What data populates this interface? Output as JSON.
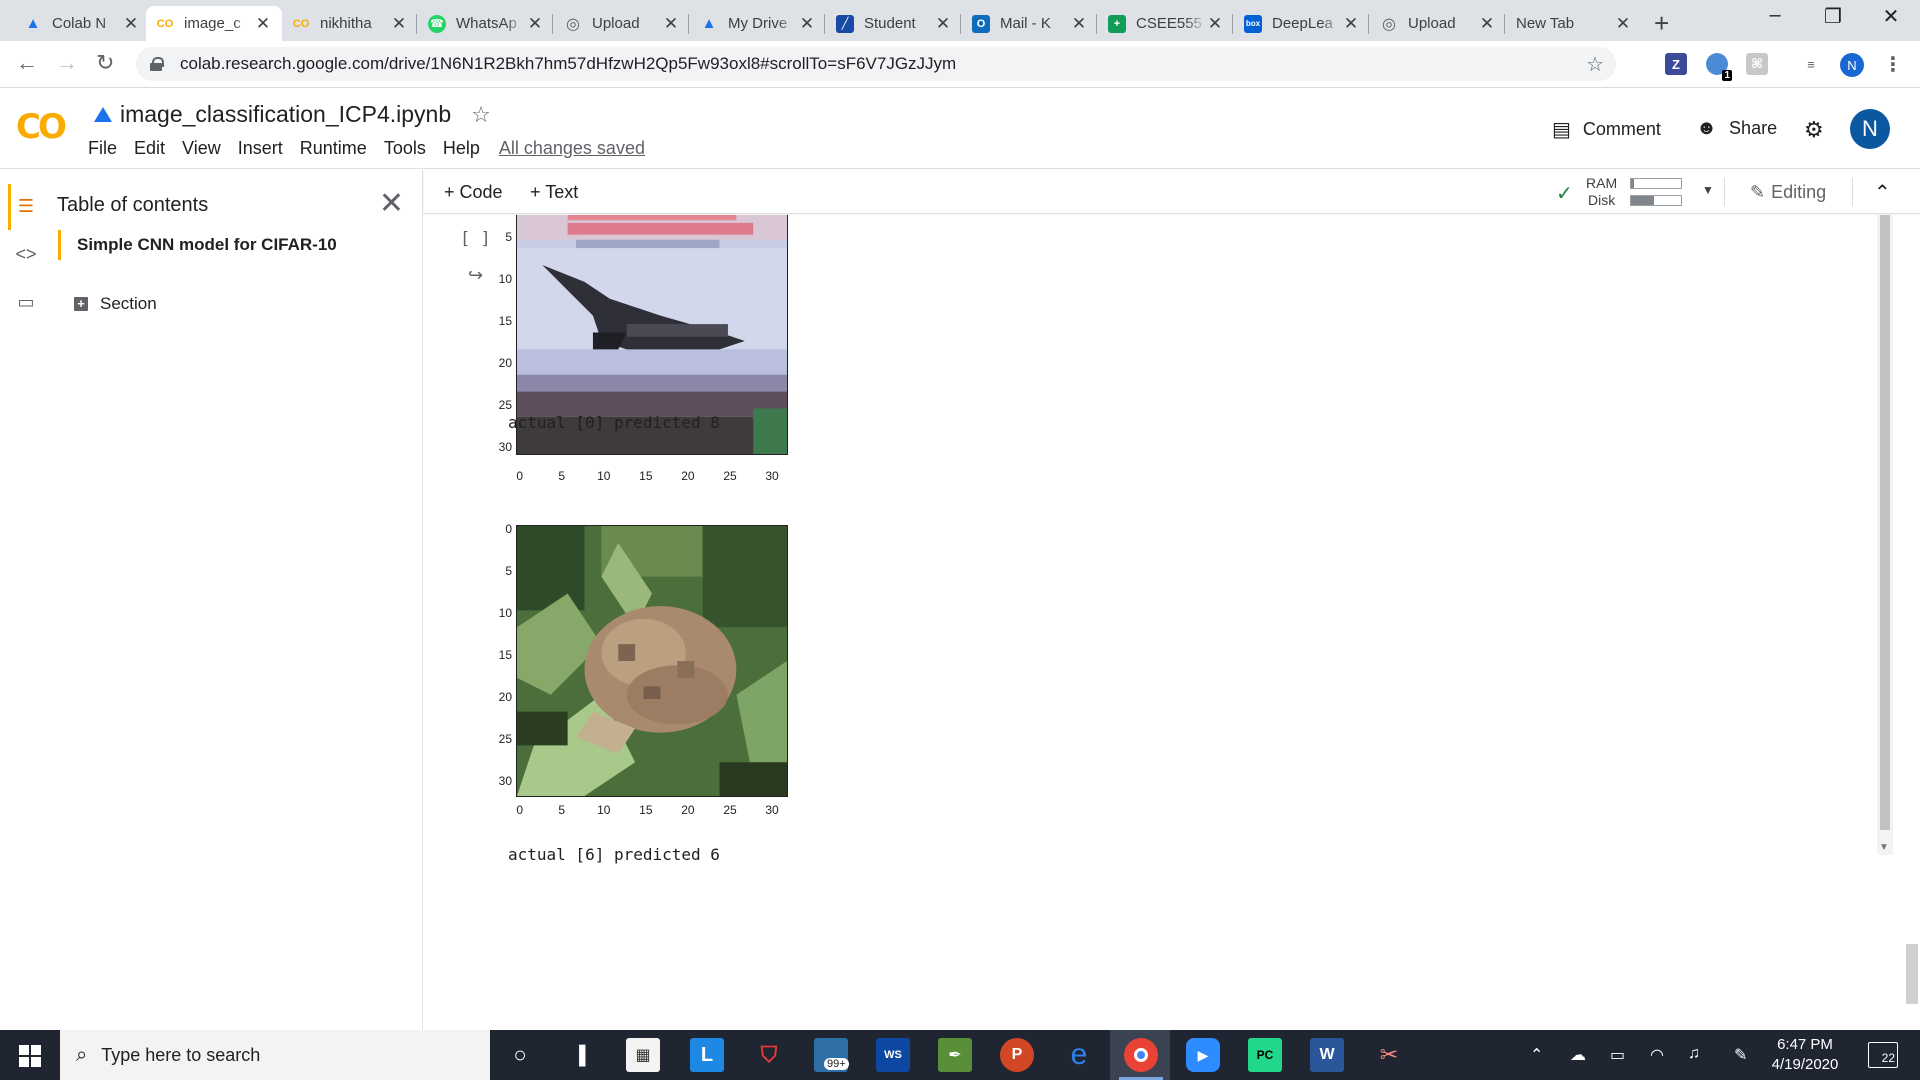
{
  "browser": {
    "tabs": [
      {
        "title": "Colab N",
        "icon": "google-drive-icon",
        "color": "#1a73e8",
        "active": false
      },
      {
        "title": "image_c",
        "icon": "colab-icon",
        "color": "#f9ab00",
        "active": true
      },
      {
        "title": "nikhitha",
        "icon": "colab-icon",
        "color": "#f9ab00",
        "active": false
      },
      {
        "title": "WhatsAp",
        "icon": "whatsapp-icon",
        "color": "#25d366",
        "active": false
      },
      {
        "title": "Upload",
        "icon": "globe-icon",
        "color": "#5f6368",
        "active": false
      },
      {
        "title": "My Drive",
        "icon": "google-drive-icon",
        "color": "#1a73e8",
        "active": false
      },
      {
        "title": "Student",
        "icon": "student-portal-icon",
        "color": "#1a4aa8",
        "active": false
      },
      {
        "title": "Mail - K",
        "icon": "outlook-icon",
        "color": "#0f6cbd",
        "active": false
      },
      {
        "title": "CSEE555",
        "icon": "sheets-icon",
        "color": "#0f9d58",
        "active": false
      },
      {
        "title": "DeepLea",
        "icon": "box-icon",
        "color": "#0061d5",
        "active": false
      },
      {
        "title": "Upload",
        "icon": "globe-icon",
        "color": "#5f6368",
        "active": false
      },
      {
        "title": "New Tab",
        "icon": "",
        "color": "",
        "active": false
      }
    ],
    "url": "colab.research.google.com/drive/1N6N1R2Bkh7hm57dHfzwH2Qp5Fw93oxl8#scrollTo=sF6V7JGzJJym",
    "profile_initial": "N",
    "extension_badge": "1"
  },
  "colab": {
    "notebook_title": "image_classification_ICP4.ipynb",
    "menu": [
      "File",
      "Edit",
      "View",
      "Insert",
      "Runtime",
      "Tools",
      "Help"
    ],
    "save_status": "All changes saved",
    "comment_label": "Comment",
    "share_label": "Share",
    "avatar_initial": "N",
    "toolbar": {
      "code_label": "+ Code",
      "text_label": "+ Text",
      "ram_label": "RAM",
      "disk_label": "Disk",
      "ram_usage": 0.05,
      "disk_usage": 0.45,
      "editing_label": "Editing"
    },
    "toc": {
      "title": "Table of contents",
      "entries": [
        "Simple CNN model for CIFAR-10"
      ],
      "section_label": "Section"
    },
    "cell": {
      "run_indicator": "[ ]",
      "plots": [
        {
          "subject": "airplane",
          "yticks": [
            "5",
            "10",
            "15",
            "20",
            "25",
            "30"
          ],
          "xticks": [
            "0",
            "5",
            "10",
            "15",
            "20",
            "25",
            "30"
          ],
          "caption": "actual [0] predicted 8"
        },
        {
          "subject": "frog",
          "yticks": [
            "0",
            "5",
            "10",
            "15",
            "20",
            "25",
            "30"
          ],
          "xticks": [
            "0",
            "5",
            "10",
            "15",
            "20",
            "25",
            "30"
          ],
          "caption": "actual [6] predicted 6"
        }
      ]
    }
  },
  "taskbar": {
    "search_placeholder": "Type here to search",
    "time": "6:47 PM",
    "date": "4/19/2020",
    "notification_count": "22",
    "mail_badge": "99+"
  }
}
